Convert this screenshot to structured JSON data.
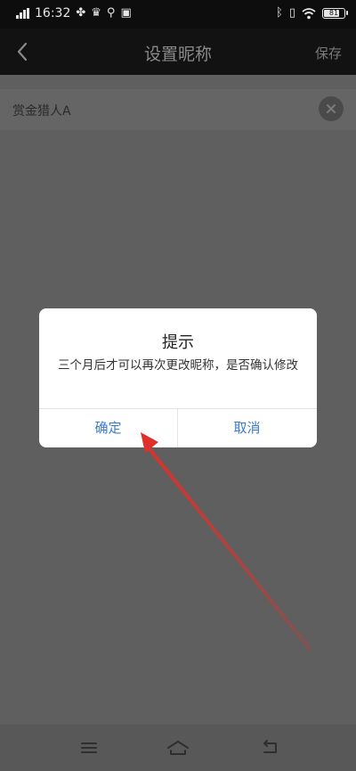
{
  "status_bar": {
    "time": "16:32",
    "battery_text": "81",
    "battery_level": 0.81
  },
  "header": {
    "title": "设置昵称",
    "save_label": "保存"
  },
  "nickname": {
    "value": "赏金猎人A"
  },
  "dialog": {
    "title": "提示",
    "message": "三个月后才可以再次更改昵称，是否确认修改",
    "confirm_label": "确定",
    "cancel_label": "取消"
  },
  "annotation": {
    "arrow_color": "#e0302a"
  },
  "colors": {
    "accent": "#3b7ad1",
    "overlay": "#5f5f5f"
  }
}
